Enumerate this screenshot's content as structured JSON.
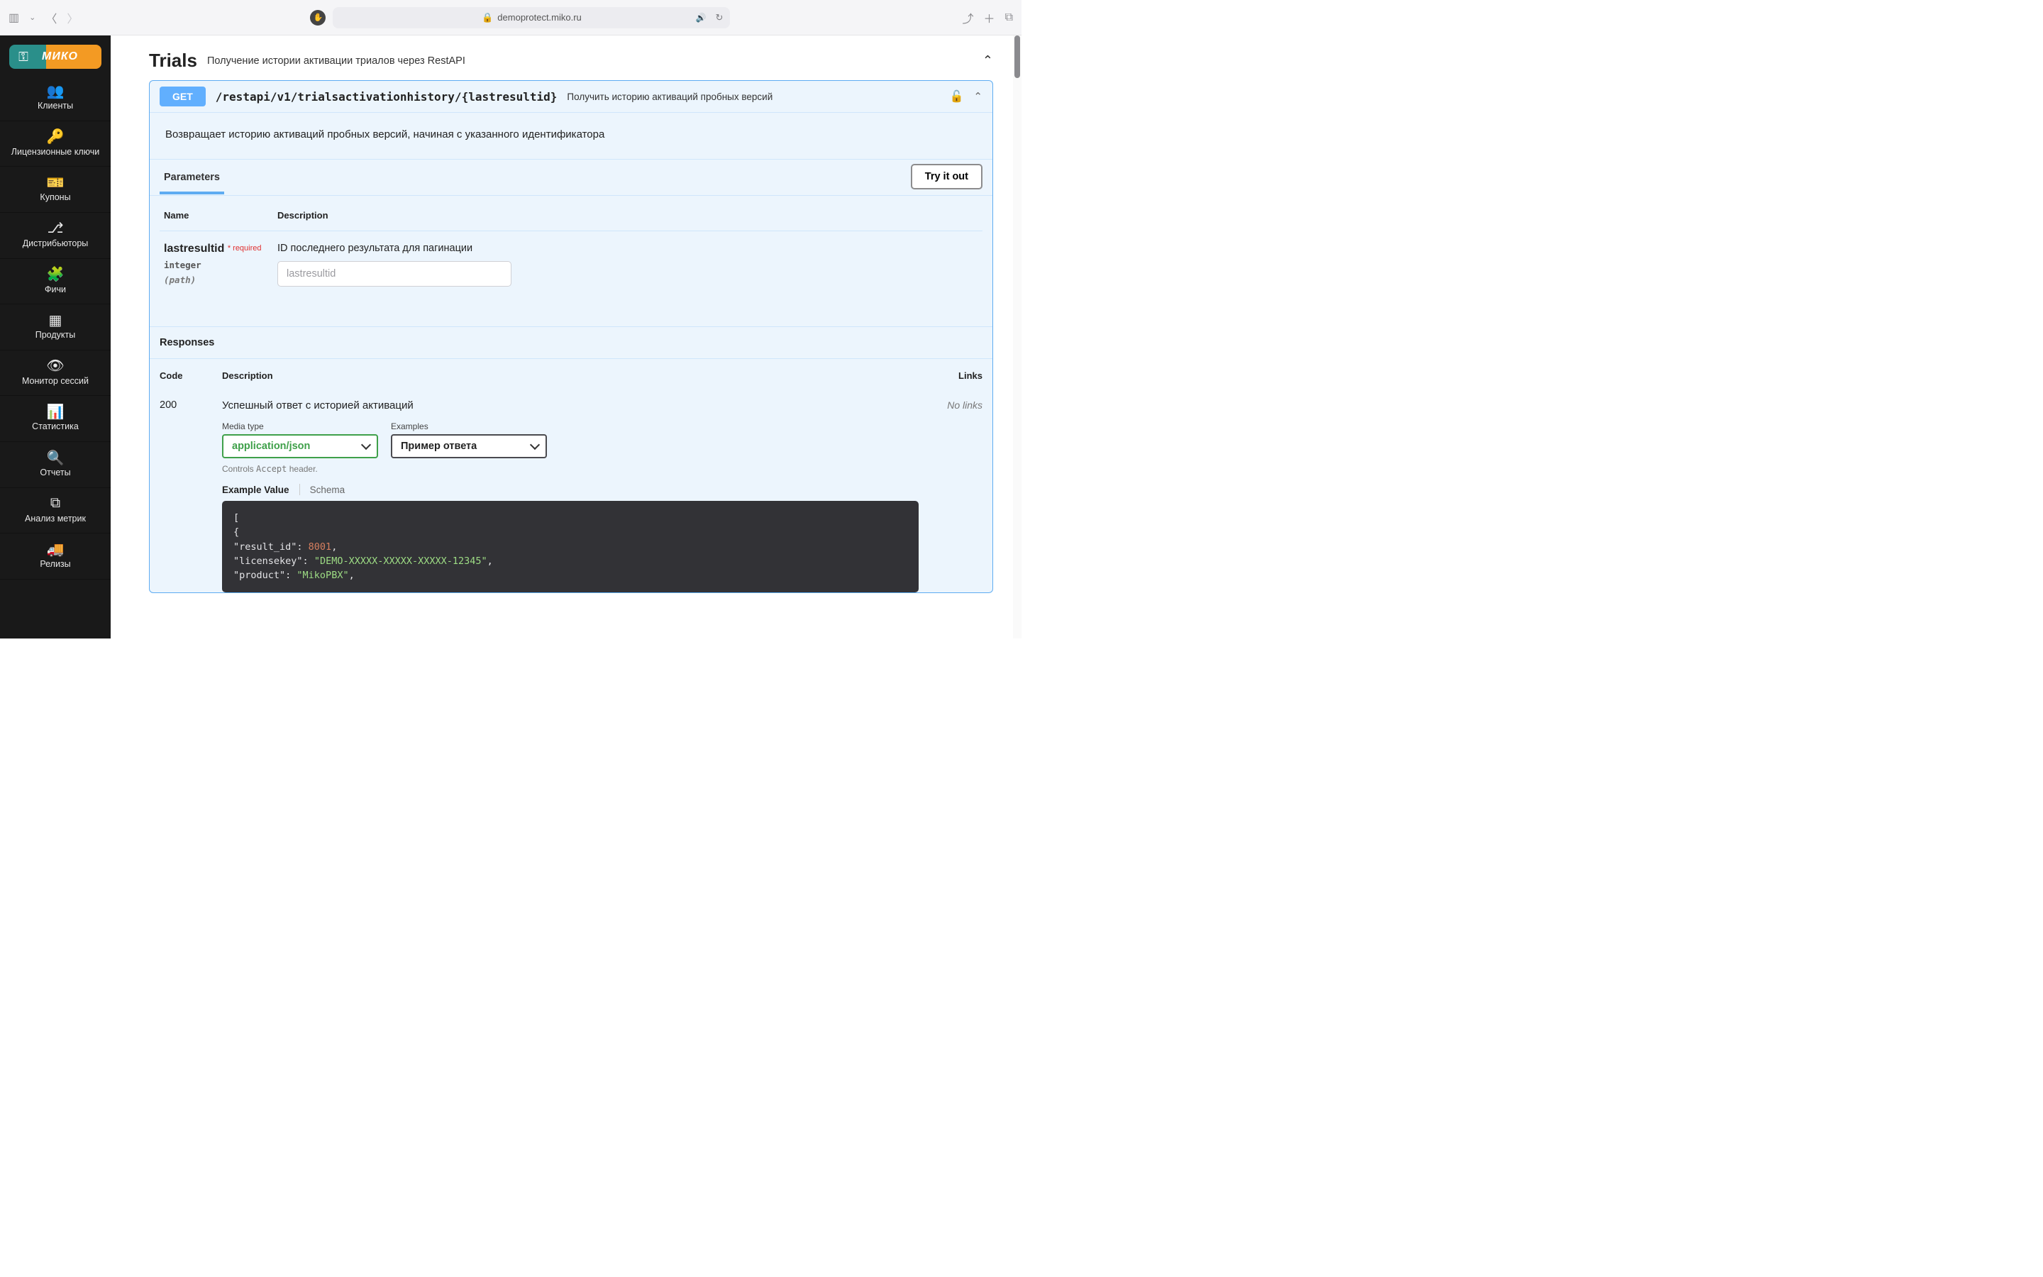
{
  "browser": {
    "url_display": "demoprotect.miko.ru"
  },
  "logo": {
    "text": "МИКО"
  },
  "sidebar": {
    "items": [
      {
        "icon": "users-icon",
        "glyph": "👥",
        "label": "Клиенты"
      },
      {
        "icon": "key-icon",
        "glyph": "🔑",
        "label": "Лицензионные ключи"
      },
      {
        "icon": "ticket-icon",
        "glyph": "🎫",
        "label": "Купоны"
      },
      {
        "icon": "branch-icon",
        "glyph": "⎇",
        "label": "Дистрибьюторы"
      },
      {
        "icon": "puzzle-icon",
        "glyph": "🧩",
        "label": "Фичи"
      },
      {
        "icon": "grid-icon",
        "glyph": "▦",
        "label": "Продукты"
      },
      {
        "icon": "eye-icon",
        "glyph": "👁",
        "label": "Монитор сессий"
      },
      {
        "icon": "chart-icon",
        "glyph": "📊",
        "label": "Статистика"
      },
      {
        "icon": "zoom-icon",
        "glyph": "🔍",
        "label": "Отчеты"
      },
      {
        "icon": "sliders-icon",
        "glyph": "⧉",
        "label": "Анализ метрик"
      },
      {
        "icon": "truck-icon",
        "glyph": "🚚",
        "label": "Релизы"
      }
    ]
  },
  "tag": {
    "name": "Trials",
    "desc": "Получение истории активации триалов через RestAPI"
  },
  "endpoint": {
    "method": "GET",
    "path": "/restapi/v1/trialsactivationhistory/{lastresultid}",
    "summary": "Получить историю активаций пробных версий",
    "description": "Возвращает историю активаций пробных версий, начиная с указанного идентификатора"
  },
  "paramSection": {
    "tab": "Parameters",
    "tryBtn": "Try it out",
    "col_name": "Name",
    "col_desc": "Description"
  },
  "param": {
    "name": "lastresultid",
    "required": "required",
    "type": "integer",
    "in": "(path)",
    "desc": "ID последнего результата для пагинации",
    "placeholder": "lastresultid"
  },
  "responses": {
    "title": "Responses",
    "col_code": "Code",
    "col_desc": "Description",
    "col_links": "Links",
    "code": "200",
    "desc": "Успешный ответ с историей активаций",
    "links": "No links",
    "mt_label": "Media type",
    "mt_value": "application/json",
    "accept_note_1": "Controls ",
    "accept_note_2": "Accept",
    "accept_note_3": " header.",
    "ex_label": "Examples",
    "ex_value": "Пример ответа",
    "example_tab": "Example Value",
    "schema_tab": "Schema"
  },
  "example_json": {
    "l1": "[",
    "l2": "  {",
    "l3a": "    \"result_id\"",
    "l3b": ": ",
    "l3c": "8001",
    "l3d": ",",
    "l4a": "    \"licensekey\"",
    "l4b": ": ",
    "l4c": "\"DEMO-XXXXX-XXXXX-XXXXX-12345\"",
    "l4d": ",",
    "l5a": "    \"product\"",
    "l5b": ": ",
    "l5c": "\"MikoPBX\"",
    "l5d": ","
  }
}
